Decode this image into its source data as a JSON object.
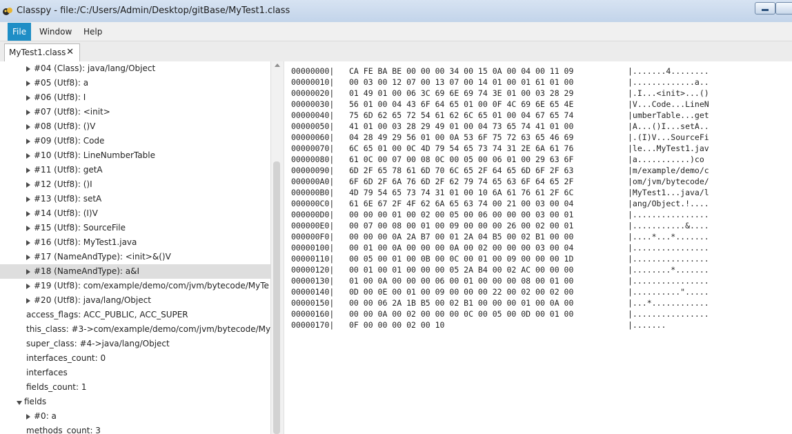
{
  "window": {
    "title": "Classpy - file:/C:/Users/Admin/Desktop/gitBase/MyTest1.class"
  },
  "menu": [
    "File",
    "Window",
    "Help"
  ],
  "tab": {
    "label": "MyTest1.class",
    "close": "✕"
  },
  "tree": [
    {
      "text": "#04 (Class): java/lang/Object",
      "expander": "collapsed",
      "indent": 1
    },
    {
      "text": "#05 (Utf8): a",
      "expander": "collapsed",
      "indent": 1
    },
    {
      "text": "#06 (Utf8): I",
      "expander": "collapsed",
      "indent": 1
    },
    {
      "text": "#07 (Utf8): <init>",
      "expander": "collapsed",
      "indent": 1
    },
    {
      "text": "#08 (Utf8): ()V",
      "expander": "collapsed",
      "indent": 1
    },
    {
      "text": "#09 (Utf8): Code",
      "expander": "collapsed",
      "indent": 1
    },
    {
      "text": "#10 (Utf8): LineNumberTable",
      "expander": "collapsed",
      "indent": 1
    },
    {
      "text": "#11 (Utf8): getA",
      "expander": "collapsed",
      "indent": 1
    },
    {
      "text": "#12 (Utf8): ()I",
      "expander": "collapsed",
      "indent": 1
    },
    {
      "text": "#13 (Utf8): setA",
      "expander": "collapsed",
      "indent": 1
    },
    {
      "text": "#14 (Utf8): (I)V",
      "expander": "collapsed",
      "indent": 1
    },
    {
      "text": "#15 (Utf8): SourceFile",
      "expander": "collapsed",
      "indent": 1
    },
    {
      "text": "#16 (Utf8): MyTest1.java",
      "expander": "collapsed",
      "indent": 1
    },
    {
      "text": "#17 (NameAndType): <init>&()V",
      "expander": "collapsed",
      "indent": 1
    },
    {
      "text": "#18 (NameAndType): a&I",
      "expander": "collapsed",
      "indent": 1,
      "selected": true
    },
    {
      "text": "#19 (Utf8): com/example/demo/com/jvm/bytecode/MyTe",
      "expander": "collapsed",
      "indent": 1
    },
    {
      "text": "#20 (Utf8): java/lang/Object",
      "expander": "collapsed",
      "indent": 1
    },
    {
      "text": "access_flags: ACC_PUBLIC, ACC_SUPER",
      "expander": "none",
      "indent": 1
    },
    {
      "text": "this_class: #3->com/example/demo/com/jvm/bytecode/My",
      "expander": "none",
      "indent": 1
    },
    {
      "text": "super_class: #4->java/lang/Object",
      "expander": "none",
      "indent": 1
    },
    {
      "text": "interfaces_count: 0",
      "expander": "none",
      "indent": 1
    },
    {
      "text": "interfaces",
      "expander": "none",
      "indent": 1
    },
    {
      "text": "fields_count: 1",
      "expander": "none",
      "indent": 1
    },
    {
      "text": "fields",
      "expander": "expanded",
      "indent": 0
    },
    {
      "text": "#0: a",
      "expander": "collapsed",
      "indent": 1
    },
    {
      "text": "methods_count: 3",
      "expander": "none",
      "indent": 1
    }
  ],
  "hex": [
    {
      "addr": "00000000|",
      "bytes": "CA FE BA BE 00 00 00 34 00 15 0A 00 04 00 11 09",
      "ascii": "|.......4........"
    },
    {
      "addr": "00000010|",
      "bytes": "00 03 00 12 07 00 13 07 00 14 01 00 01 61 01 00",
      "ascii": "|.............a.."
    },
    {
      "addr": "00000020|",
      "bytes": "01 49 01 00 06 3C 69 6E 69 74 3E 01 00 03 28 29",
      "ascii": "|.I...<init>...()"
    },
    {
      "addr": "00000030|",
      "bytes": "56 01 00 04 43 6F 64 65 01 00 0F 4C 69 6E 65 4E",
      "ascii": "|V...Code...LineN"
    },
    {
      "addr": "00000040|",
      "bytes": "75 6D 62 65 72 54 61 62 6C 65 01 00 04 67 65 74",
      "ascii": "|umberTable...get"
    },
    {
      "addr": "00000050|",
      "bytes": "41 01 00 03 28 29 49 01 00 04 73 65 74 41 01 00",
      "ascii": "|A...()I...setA.."
    },
    {
      "addr": "00000060|",
      "bytes": "04 28 49 29 56 01 00 0A 53 6F 75 72 63 65 46 69",
      "ascii": "|.(I)V...SourceFi"
    },
    {
      "addr": "00000070|",
      "bytes": "6C 65 01 00 0C 4D 79 54 65 73 74 31 2E 6A 61 76",
      "ascii": "|le...MyTest1.jav"
    },
    {
      "addr": "00000080|",
      "bytes": "61 0C 00 07 00 08 0C 00 05 00 06 01 00 29 63 6F",
      "ascii": "|a...........)co"
    },
    {
      "addr": "00000090|",
      "bytes": "6D 2F 65 78 61 6D 70 6C 65 2F 64 65 6D 6F 2F 63",
      "ascii": "|m/example/demo/c"
    },
    {
      "addr": "000000A0|",
      "bytes": "6F 6D 2F 6A 76 6D 2F 62 79 74 65 63 6F 64 65 2F",
      "ascii": "|om/jvm/bytecode/"
    },
    {
      "addr": "000000B0|",
      "bytes": "4D 79 54 65 73 74 31 01 00 10 6A 61 76 61 2F 6C",
      "ascii": "|MyTest1...java/l"
    },
    {
      "addr": "000000C0|",
      "bytes": "61 6E 67 2F 4F 62 6A 65 63 74 00 21 00 03 00 04",
      "ascii": "|ang/Object.!...."
    },
    {
      "addr": "000000D0|",
      "bytes": "00 00 00 01 00 02 00 05 00 06 00 00 00 03 00 01",
      "ascii": "|................"
    },
    {
      "addr": "000000E0|",
      "bytes": "00 07 00 08 00 01 00 09 00 00 00 26 00 02 00 01",
      "ascii": "|...........&...."
    },
    {
      "addr": "000000F0|",
      "bytes": "00 00 00 0A 2A B7 00 01 2A 04 B5 00 02 B1 00 00",
      "ascii": "|....*...*......."
    },
    {
      "addr": "00000100|",
      "bytes": "00 01 00 0A 00 00 00 0A 00 02 00 00 00 03 00 04",
      "ascii": "|................"
    },
    {
      "addr": "00000110|",
      "bytes": "00 05 00 01 00 0B 00 0C 00 01 00 09 00 00 00 1D",
      "ascii": "|................"
    },
    {
      "addr": "00000120|",
      "bytes": "00 01 00 01 00 00 00 05 2A B4 00 02 AC 00 00 00",
      "ascii": "|........*......."
    },
    {
      "addr": "00000130|",
      "bytes": "01 00 0A 00 00 00 06 00 01 00 00 00 08 00 01 00",
      "ascii": "|................"
    },
    {
      "addr": "00000140|",
      "bytes": "0D 00 0E 00 01 00 09 00 00 00 22 00 02 00 02 00",
      "ascii": "|..........\"....."
    },
    {
      "addr": "00000150|",
      "bytes": "00 00 06 2A 1B B5 00 02 B1 00 00 00 01 00 0A 00",
      "ascii": "|...*............"
    },
    {
      "addr": "00000160|",
      "bytes": "00 00 0A 00 02 00 00 00 0C 00 05 00 0D 00 01 00",
      "ascii": "|................"
    },
    {
      "addr": "00000170|",
      "bytes": "0F 00 00 00 02 00 10",
      "ascii": "|......."
    }
  ]
}
